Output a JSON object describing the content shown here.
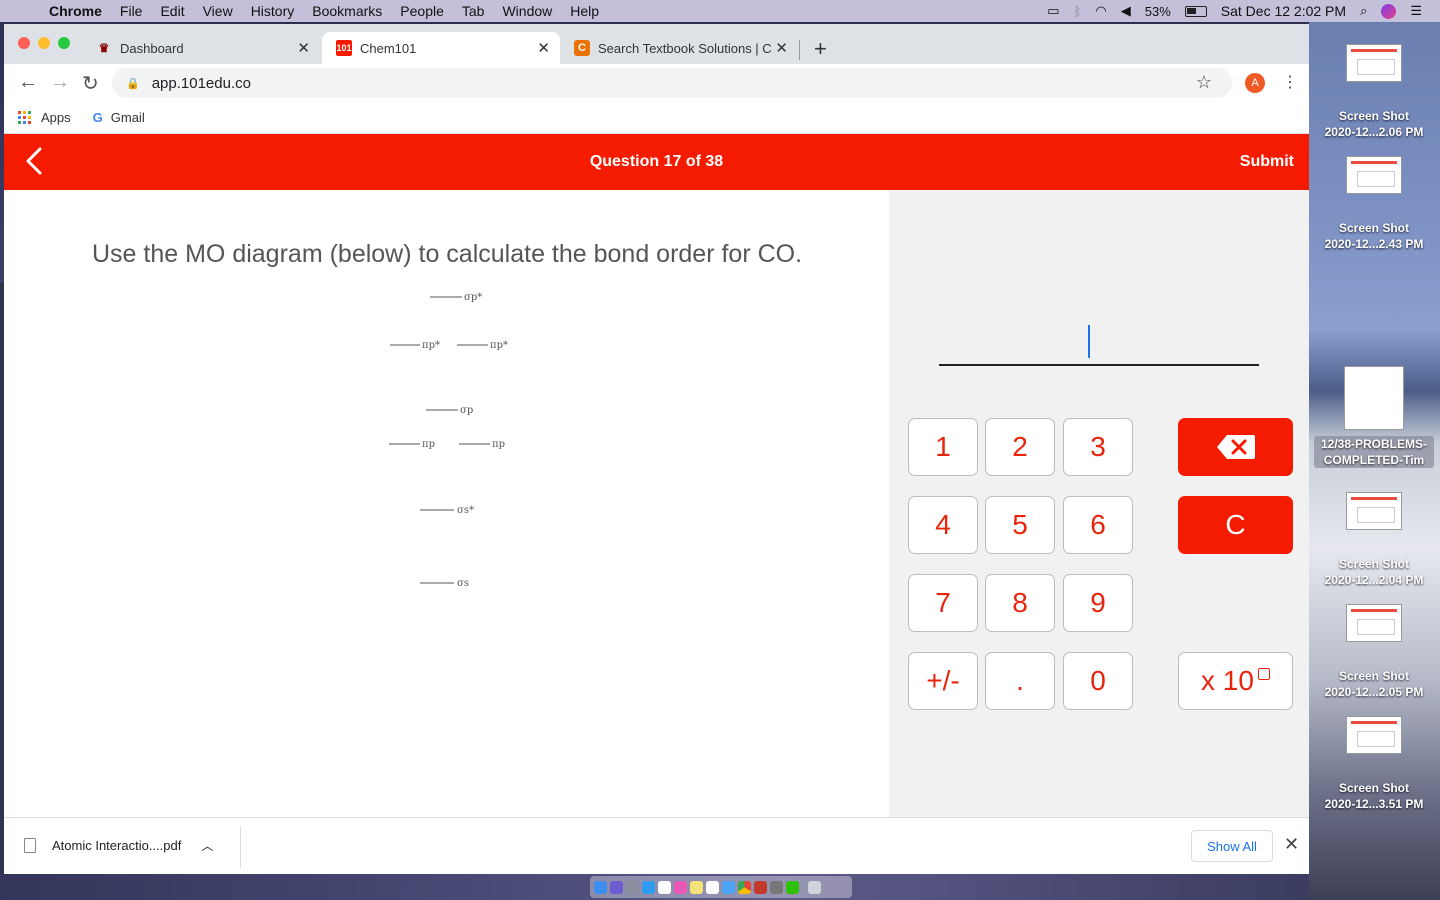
{
  "menubar": {
    "app": "Chrome",
    "items": [
      "File",
      "Edit",
      "View",
      "History",
      "Bookmarks",
      "People",
      "Tab",
      "Window",
      "Help"
    ],
    "battery": "53%",
    "clock": "Sat Dec 12  2:02 PM"
  },
  "tabs": [
    {
      "title": "Dashboard",
      "favicon": "dashboard-favicon"
    },
    {
      "title": "Chem101",
      "favicon_text": "101"
    },
    {
      "title": "Search Textbook Solutions | Ch",
      "favicon_text": "C"
    }
  ],
  "toolbar": {
    "url": "app.101edu.co",
    "avatar": "A"
  },
  "bookmarks": [
    {
      "label": "Apps"
    },
    {
      "label": "Gmail",
      "icon_text": "G"
    }
  ],
  "header": {
    "title": "Question 17 of 38",
    "submit": "Submit"
  },
  "question": {
    "text": "Use the MO diagram (below) to calculate the bond order for CO."
  },
  "mo_diagram": {
    "levels": [
      {
        "label": "σp*"
      },
      {
        "label": "πp*"
      },
      {
        "label": "σp"
      },
      {
        "label": "πp"
      },
      {
        "label": "σs*"
      },
      {
        "label": "σs"
      }
    ]
  },
  "keypad": {
    "digits": [
      "1",
      "2",
      "3",
      "4",
      "5",
      "6",
      "7",
      "8",
      "9",
      "+/-",
      ".",
      "0"
    ],
    "clear": "C",
    "exponent": "x 10"
  },
  "downloads": {
    "file": "Atomic Interactio....pdf",
    "show_all": "Show All"
  },
  "desktop": {
    "icons": [
      {
        "label": "Screen Shot\n2020-12...2.06 PM"
      },
      {
        "label": "Screen Shot\n2020-12...2.43 PM"
      },
      {
        "label": "12/38-PROBLEMS-\nCOMPLETED-Tim"
      },
      {
        "label": "Screen Shot\n2020-12...2.04 PM"
      },
      {
        "label": "Screen Shot\n2020-12...2.05 PM"
      },
      {
        "label": "Screen Shot\n2020-12...3.51 PM"
      }
    ]
  },
  "colors": {
    "brand_red": "#f51b00",
    "link_blue": "#1a73e8"
  }
}
